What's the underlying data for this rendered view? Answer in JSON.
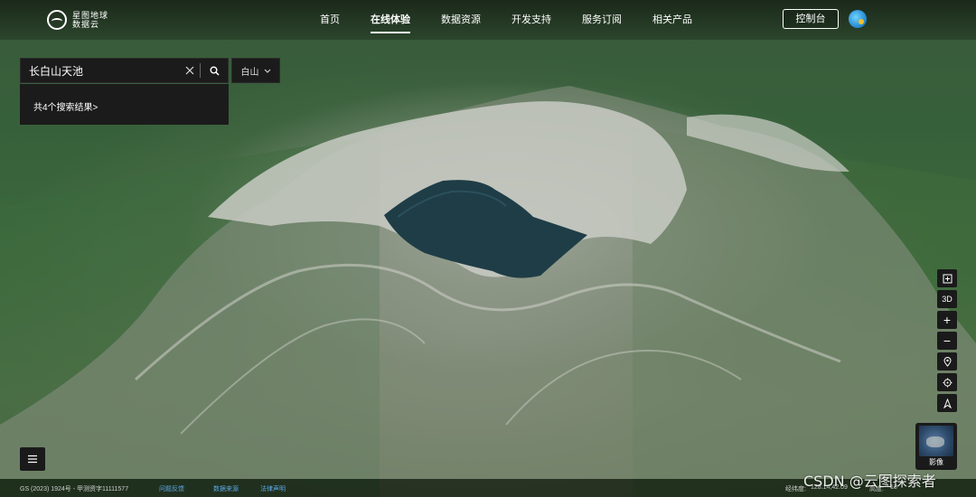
{
  "brand": {
    "line1": "星图地球",
    "line2": "数据云"
  },
  "nav": {
    "items": [
      {
        "label": "首页",
        "active": false
      },
      {
        "label": "在线体验",
        "active": true
      },
      {
        "label": "数据资源",
        "active": false
      },
      {
        "label": "开发支持",
        "active": false
      },
      {
        "label": "服务订阅",
        "active": false
      },
      {
        "label": "相关产品",
        "active": false
      }
    ],
    "console_label": "控制台"
  },
  "search": {
    "value": "长白山天池",
    "region": "白山",
    "results_text": "共4个搜索结果>"
  },
  "tools": {
    "items": [
      {
        "icon": "rect-select-icon",
        "label": "⊞"
      },
      {
        "icon": "3d-view-icon",
        "label": "3D"
      },
      {
        "icon": "zoom-in-icon",
        "label": "+"
      },
      {
        "icon": "zoom-out-icon",
        "label": "−"
      },
      {
        "icon": "location-pin-icon",
        "label": ""
      },
      {
        "icon": "target-icon",
        "label": ""
      },
      {
        "icon": "compass-icon",
        "label": ""
      }
    ]
  },
  "basemap": {
    "label": "影像"
  },
  "footer": {
    "copyright": "GS (2023) 1924号 - 甲测资字11111577",
    "feedback": "问题反馈",
    "data_source": "数据来源",
    "legal": "法律声明",
    "coord_label": "经纬度:",
    "coord_value": "128.14,42.09",
    "alt_label": "高度:",
    "alt_value": "13"
  },
  "watermark": "CSDN @云图探索者"
}
